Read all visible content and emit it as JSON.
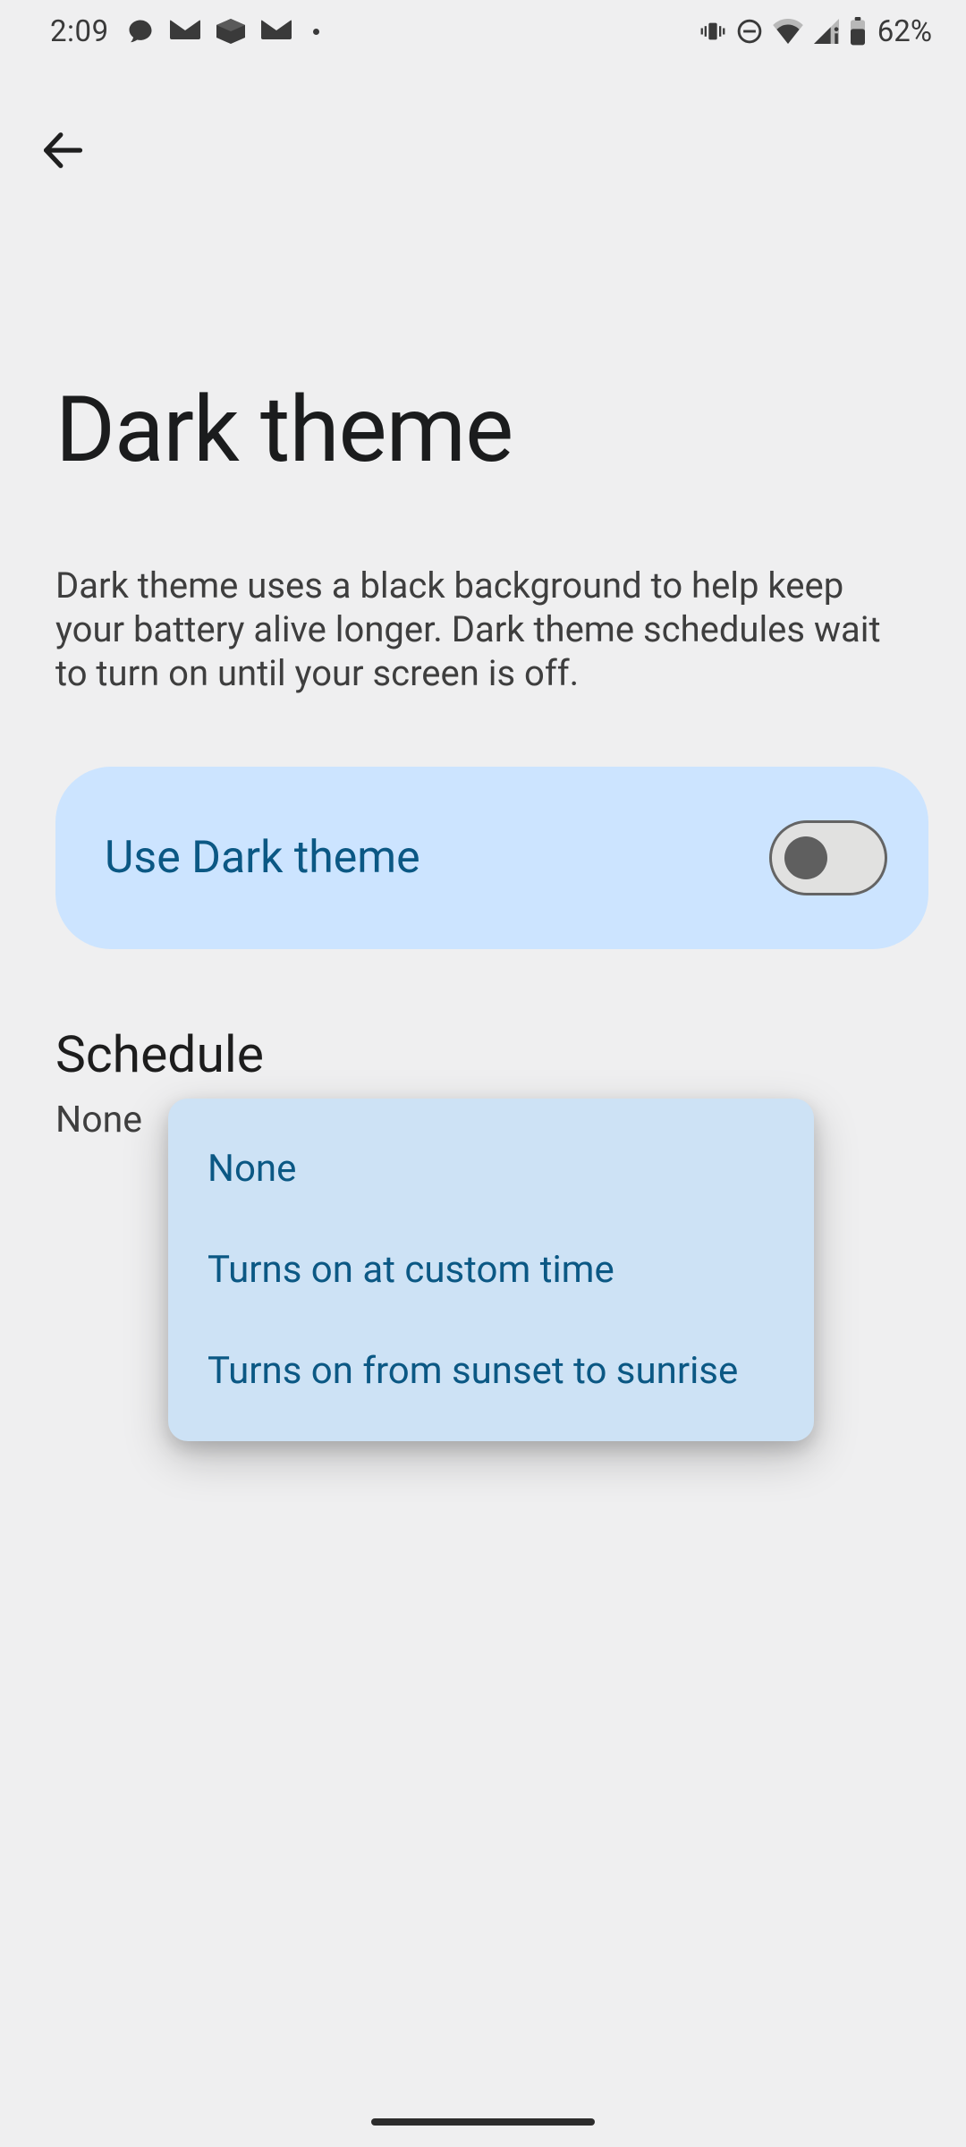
{
  "statusbar": {
    "time": "2:09",
    "battery": "62%"
  },
  "page": {
    "title": "Dark theme",
    "description": "Dark theme uses a black background to help keep your battery alive longer. Dark theme schedules wait to turn on until your screen is off."
  },
  "toggle": {
    "label": "Use Dark theme",
    "state": "off"
  },
  "schedule": {
    "title": "Schedule",
    "value": "None"
  },
  "popup": {
    "options": [
      "None",
      "Turns on at custom time",
      "Turns on from sunset to sunrise"
    ]
  },
  "icons": {
    "back": "arrow-back",
    "status_left": [
      "chat-bubble-icon",
      "mail-outbox-icon",
      "box-icon",
      "mail-outbox-icon-2"
    ],
    "status_right": [
      "vibrate-icon",
      "dnd-icon",
      "wifi-icon",
      "signal-icon",
      "battery-icon"
    ]
  }
}
